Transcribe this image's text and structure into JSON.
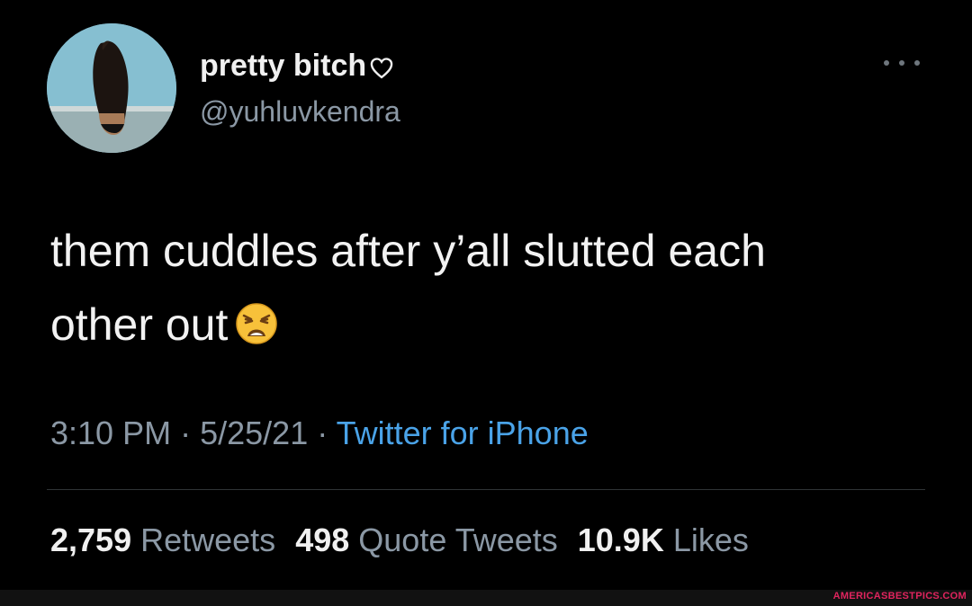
{
  "tweet": {
    "display_name": "pretty bitch",
    "handle": "@yuhluvkendra",
    "text_line1": "them cuddles after y’all slutted each",
    "text_line2": "other out",
    "time": "3:10 PM",
    "separator": "·",
    "date": "5/25/21",
    "source": "Twitter for iPhone",
    "retweets_count": "2,759",
    "retweets_label": "Retweets",
    "quotes_count": "498",
    "quotes_label": "Quote Tweets",
    "likes_count": "10.9K",
    "likes_label": "Likes"
  },
  "icons": {
    "name_icon": "heart-outline-icon",
    "emoji": "weary-face-emoji",
    "more": "more-options-icon"
  },
  "watermark": "AMERICASBESTPICS.COM",
  "colors": {
    "background": "#000000",
    "text": "#f2f2f2",
    "secondary": "#8b98a5",
    "link": "#4aa3e8",
    "watermark": "#e0245e"
  }
}
